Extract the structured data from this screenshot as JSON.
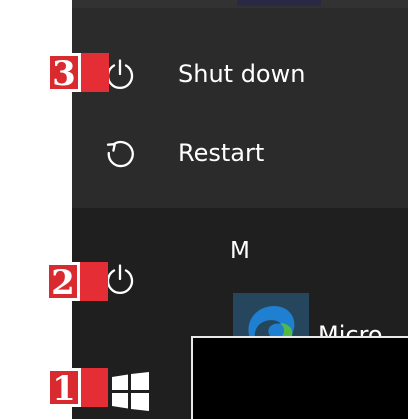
{
  "power_menu": {
    "items": [
      {
        "label": "Shut down",
        "icon": "power-icon",
        "marker": "3"
      },
      {
        "label": "Restart",
        "icon": "restart-icon"
      }
    ]
  },
  "taskbar": {
    "power_marker": "2",
    "start_marker": "1",
    "power_icon": "power-icon",
    "start_icon": "windows-icon"
  },
  "app_list": {
    "section_letter": "M",
    "visible_app_label": "Micro"
  },
  "colors": {
    "panel_dark": "#1f1f1f",
    "popup_dark": "#2b2b2b",
    "marker_red": "#d92b2f",
    "text_white": "#ffffff",
    "app_tile": "#26465d",
    "edge_blue": "#1f7fd1",
    "edge_green": "#52b947"
  }
}
